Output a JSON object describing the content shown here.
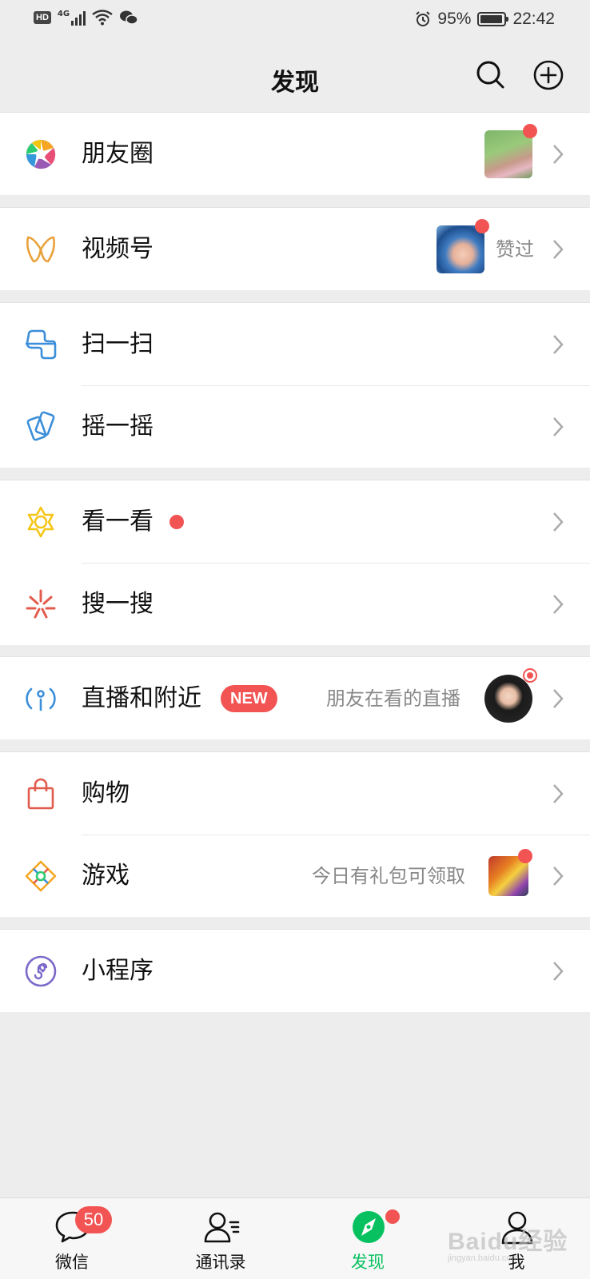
{
  "status_bar": {
    "hd": "HD",
    "network": "4G",
    "battery_percent": "95%",
    "time": "22:42",
    "battery_level": 0.95
  },
  "header": {
    "title": "发现",
    "search_icon": "search-icon",
    "add_icon": "plus-circle-icon"
  },
  "items": {
    "moments": {
      "label": "朋友圈",
      "icon": "aperture-icon",
      "has_dot": true
    },
    "channels": {
      "label": "视频号",
      "sub": "赞过",
      "icon": "channels-icon",
      "has_dot": true
    },
    "scan": {
      "label": "扫一扫",
      "icon": "scan-icon"
    },
    "shake": {
      "label": "摇一摇",
      "icon": "shake-icon"
    },
    "top_stories": {
      "label": "看一看",
      "icon": "star-flower-icon",
      "has_dot": true
    },
    "search": {
      "label": "搜一搜",
      "icon": "spark-icon"
    },
    "live_nearby": {
      "label": "直播和附近",
      "badge": "NEW",
      "sub": "朋友在看的直播",
      "icon": "live-icon"
    },
    "shopping": {
      "label": "购物",
      "icon": "shopping-bag-icon"
    },
    "games": {
      "label": "游戏",
      "sub": "今日有礼包可领取",
      "icon": "game-diamond-icon",
      "has_dot": true
    },
    "mini_programs": {
      "label": "小程序",
      "icon": "mini-program-icon"
    }
  },
  "tabbar": {
    "chats": {
      "label": "微信",
      "badge": "50",
      "icon": "chat-bubble-icon"
    },
    "contacts": {
      "label": "通讯录",
      "icon": "contacts-icon"
    },
    "discover": {
      "label": "发现",
      "icon": "compass-icon",
      "active": true
    },
    "me": {
      "label": "我",
      "icon": "person-icon"
    }
  },
  "watermark": {
    "text": "Baidu经验",
    "sub": "jingyan.baidu.com"
  },
  "colors": {
    "accent": "#07c160",
    "badge": "#f25454",
    "background": "#ededed",
    "secondary_text": "#888888"
  }
}
